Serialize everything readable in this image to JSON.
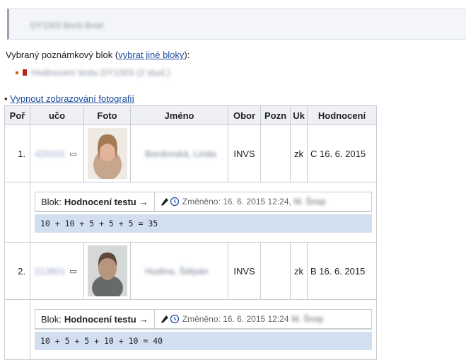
{
  "header": {
    "placeholder": "DY1003 Bock-Bvwl"
  },
  "selected_block": {
    "label": "Vybraný poznámkový blok (",
    "link": "vybrat jiné bloky",
    "suffix": "):",
    "item_text": "Hodnocení testu DY1003 (2 stud.)"
  },
  "toggle_photos": {
    "prefix": "• ",
    "link": "Vypnout zobrazování fotografií"
  },
  "table": {
    "headers": [
      "Poř",
      "učo",
      "Foto",
      "Jméno",
      "Obor",
      "Pozn",
      "Uk",
      "Hodnocení"
    ],
    "rows": [
      {
        "num": "1.",
        "uco": "420101",
        "name": "Bordovská, Linda",
        "obor": "INVS",
        "pozn": "",
        "uk": "zk",
        "hodnoceni": "C 16. 6. 2015",
        "block_label": "Blok:",
        "block_name": "Hodnocení testu",
        "arrow": "→",
        "changed": "Změněno: 16. 6. 2015 12:24,",
        "changed_by": "M. Šnop",
        "formula": "10 + 10 + 5 + 5 + 5 = 35"
      },
      {
        "num": "2.",
        "uco": "213801",
        "name": "Hudina, Štěpán",
        "obor": "INVS",
        "pozn": "",
        "uk": "zk",
        "hodnoceni": "B 16. 6. 2015",
        "block_label": "Blok:",
        "block_name": "Hodnocení testu",
        "arrow": "→",
        "changed": "Změněno: 16. 6. 2015 12:24",
        "changed_by": "M. Šnop",
        "formula": "10 + 5 + 5 + 10 + 10 = 40"
      }
    ]
  },
  "icons": {
    "message": "message-icon",
    "edit": "edit-icon",
    "history": "history-icon",
    "bullet": "bullet-icon"
  }
}
